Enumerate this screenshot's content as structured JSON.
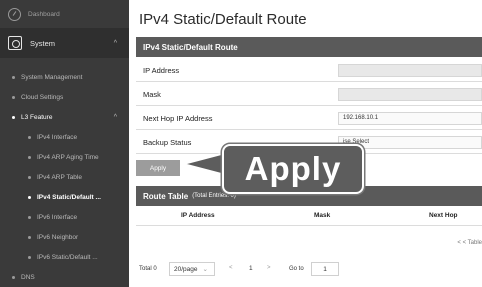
{
  "sidebar": {
    "dashboard": "Dashboard",
    "system": "System",
    "system_chevron": "^",
    "items": [
      "System Management",
      "Cloud Settings",
      "L3 Feature",
      "IPv4 Interface",
      "IPv4 ARP Aging Time",
      "IPv4 ARP Table",
      "IPv4 Static/Default ...",
      "IPv6 Interface",
      "IPv6 Neighbor",
      "IPv6 Static/Default ...",
      "DNS"
    ],
    "l3_chevron": "^"
  },
  "page_title": "IPv4 Static/Default Route",
  "form": {
    "header": "IPv4 Static/Default Route",
    "ip_label": "IP Address",
    "ip_value": "",
    "mask_label": "Mask",
    "mask_value": "",
    "next_hop_label": "Next Hop IP Address",
    "next_hop_value": "192.168.10.1",
    "backup_label": "Backup Status",
    "backup_value": "ise Select",
    "apply_label": "Apply"
  },
  "route_table": {
    "header": "Route Table",
    "entries_note": "(Total Entries: 0)",
    "columns": [
      "IP Address",
      "Mask",
      "Next Hop"
    ],
    "empty_note": "< < Table"
  },
  "pager": {
    "total": "Total 0",
    "per_page": "20/page",
    "prev": "<",
    "page": "1",
    "next": ">",
    "goto_label": "Go to",
    "goto_value": "1"
  },
  "callout": {
    "text": "Apply"
  }
}
